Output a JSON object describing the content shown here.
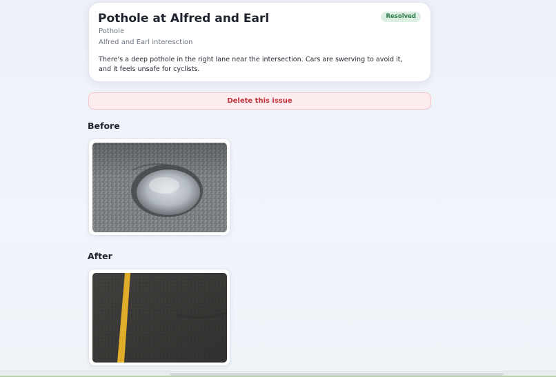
{
  "issue": {
    "title": "Pothole at Alfred and Earl",
    "category": "Pothole",
    "location": "Alfred and Earl interesction",
    "description": "There's a deep pothole in the right lane near the intersection. Cars are swerving to avoid it, and it feels unsafe for cyclists.",
    "status": "Resolved"
  },
  "actions": {
    "delete_label": "Delete this issue"
  },
  "photos": {
    "before_heading": "Before",
    "after_heading": "After"
  },
  "colors": {
    "status_bg": "#dcefe2",
    "status_text": "#2f7a4a",
    "danger_text": "#c1343d",
    "danger_bg": "#fdeced"
  }
}
